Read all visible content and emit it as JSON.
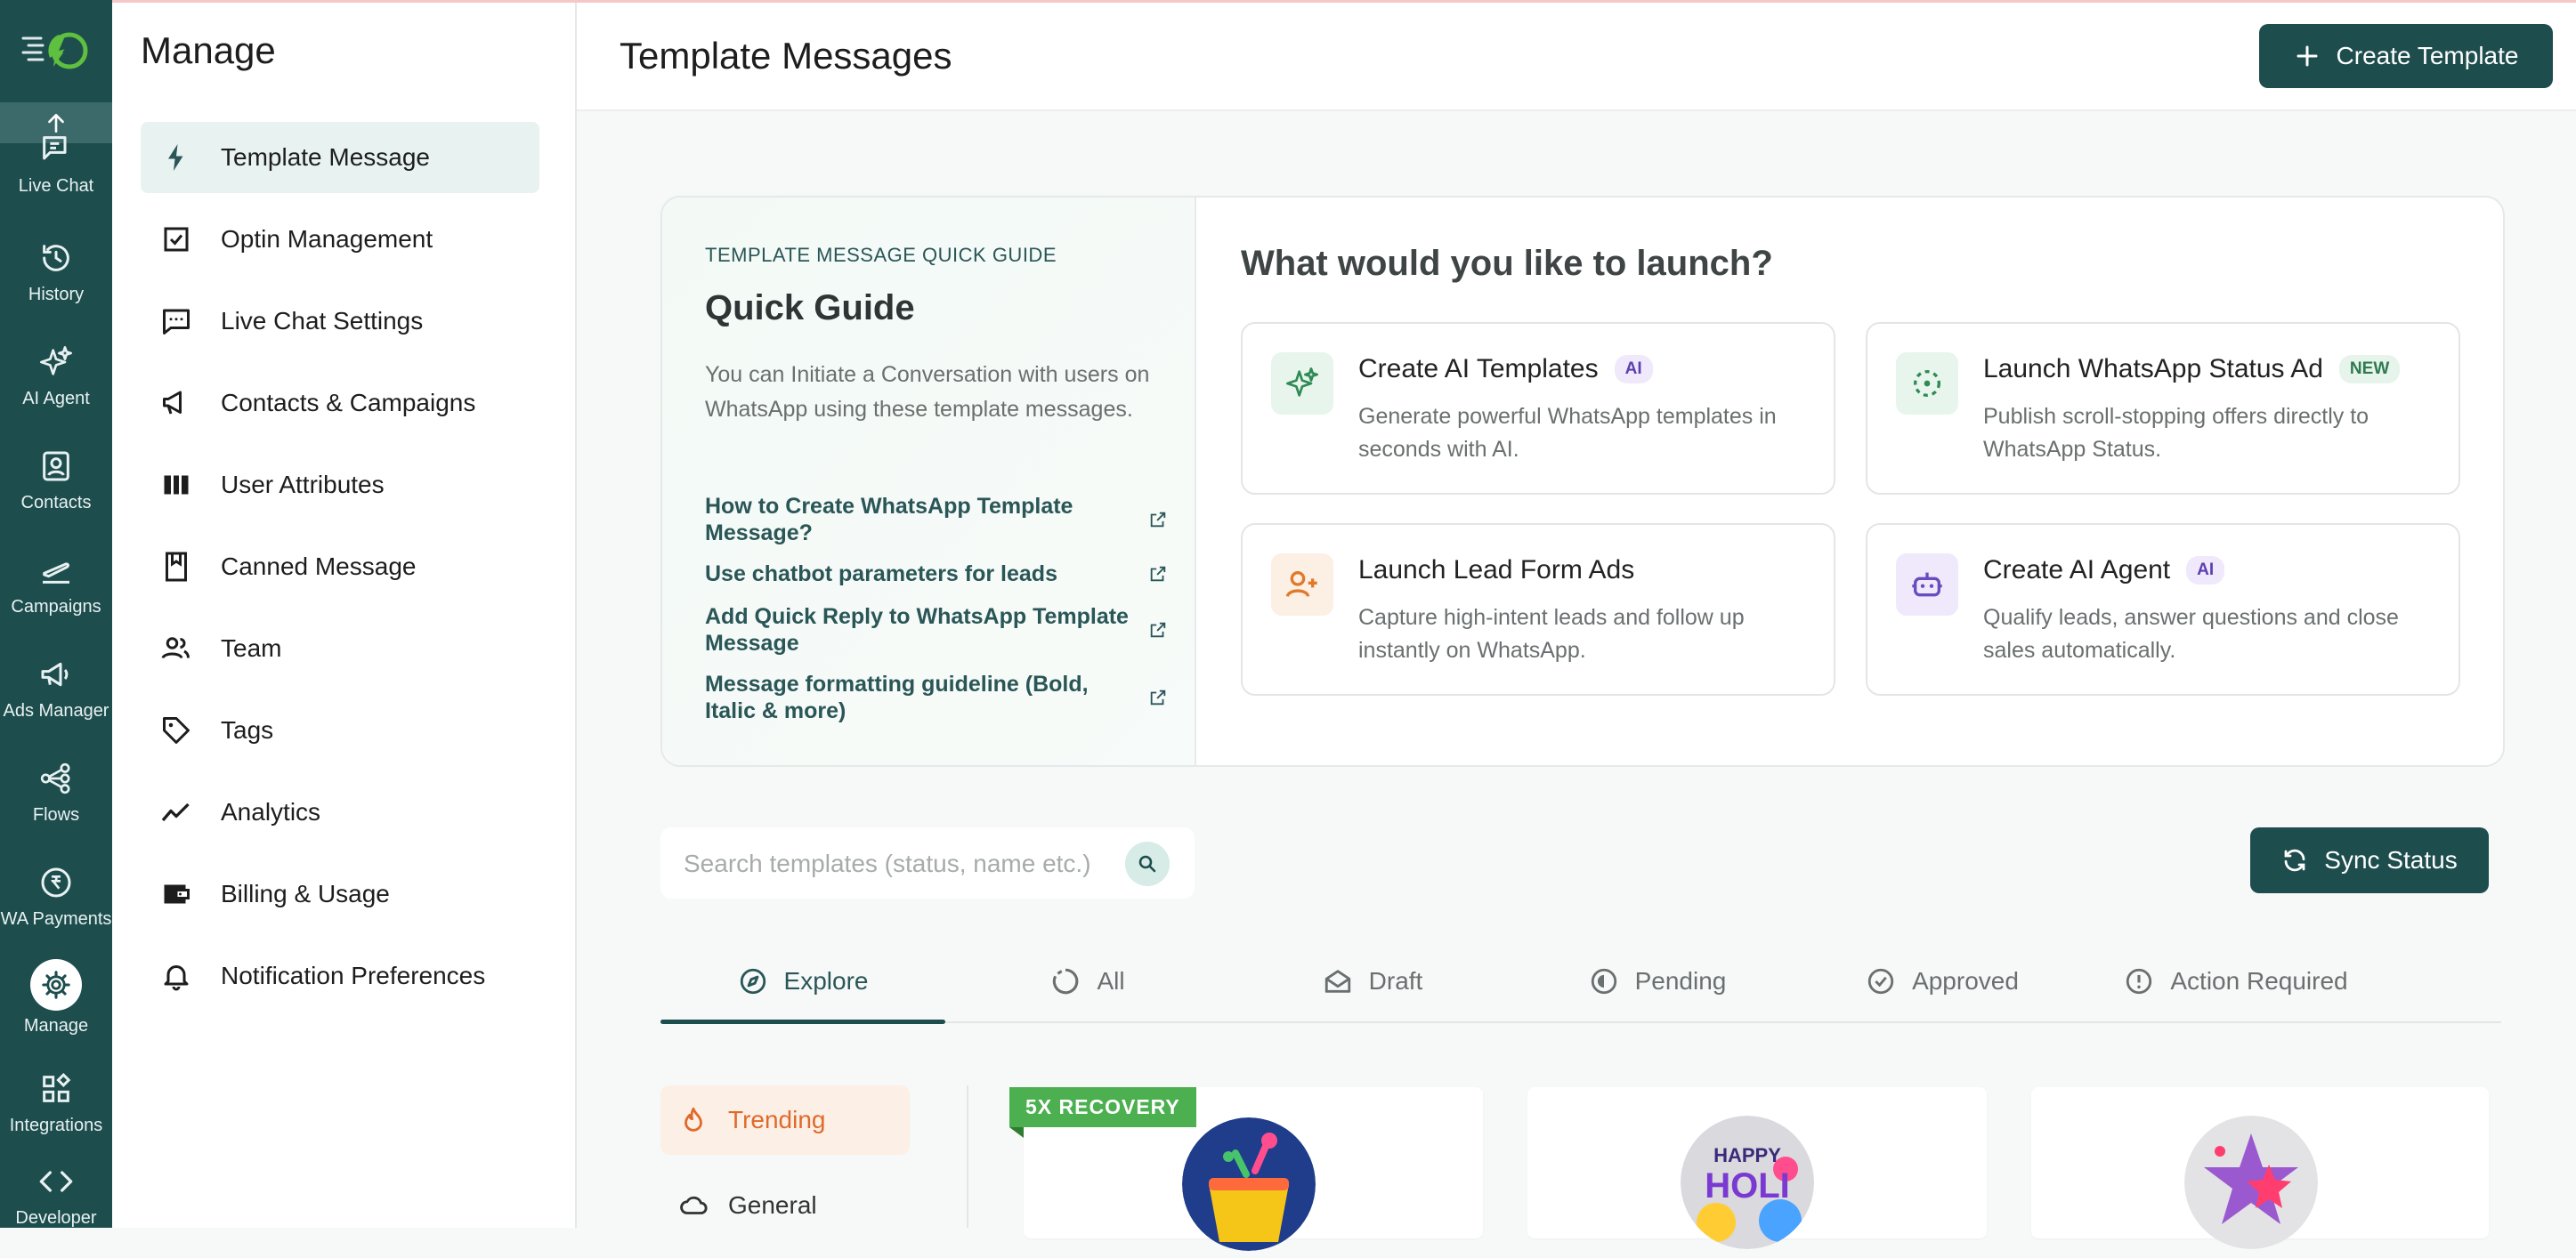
{
  "rail": {
    "items": [
      {
        "label": "Live Chat"
      },
      {
        "label": "History"
      },
      {
        "label": "AI Agent"
      },
      {
        "label": "Contacts"
      },
      {
        "label": "Campaigns"
      },
      {
        "label": "Ads Manager"
      },
      {
        "label": "Flows"
      },
      {
        "label": "WA Payments"
      },
      {
        "label": "Manage"
      },
      {
        "label": "Integrations"
      },
      {
        "label": "Developer"
      }
    ]
  },
  "manage": {
    "title": "Manage",
    "items": [
      {
        "label": "Template Message",
        "icon": "lightning-icon",
        "active": true
      },
      {
        "label": "Optin Management",
        "icon": "checkbox-icon"
      },
      {
        "label": "Live Chat Settings",
        "icon": "chat-bubble-icon"
      },
      {
        "label": "Contacts & Campaigns",
        "icon": "megaphone-icon"
      },
      {
        "label": "User Attributes",
        "icon": "columns-icon"
      },
      {
        "label": "Canned Message",
        "icon": "bookmark-icon"
      },
      {
        "label": "Team",
        "icon": "team-icon"
      },
      {
        "label": "Tags",
        "icon": "tag-icon"
      },
      {
        "label": "Analytics",
        "icon": "trend-icon"
      },
      {
        "label": "Billing & Usage",
        "icon": "wallet-icon"
      },
      {
        "label": "Notification Preferences",
        "icon": "bell-icon"
      }
    ]
  },
  "header": {
    "title": "Template Messages",
    "create_button": "Create Template"
  },
  "guide": {
    "eyebrow": "TEMPLATE MESSAGE QUICK GUIDE",
    "title": "Quick Guide",
    "description": "You can Initiate a Conversation with users on WhatsApp using these template messages.",
    "links": [
      "How to Create WhatsApp Template Message?",
      "Use chatbot parameters for leads",
      "Add Quick Reply to WhatsApp Template Message",
      "Message formatting guideline (Bold, Italic & more)"
    ],
    "launch_question": "What would you like to launch?",
    "launch_cards": [
      {
        "title": "Create AI Templates",
        "badge": "AI",
        "description": "Generate powerful WhatsApp templates in seconds with AI."
      },
      {
        "title": "Launch WhatsApp Status Ad",
        "badge": "NEW",
        "description": "Publish scroll-stopping offers directly to WhatsApp Status."
      },
      {
        "title": "Launch Lead Form Ads",
        "badge": "",
        "description": "Capture high-intent leads and follow up instantly on WhatsApp."
      },
      {
        "title": "Create AI Agent",
        "badge": "AI",
        "description": "Qualify leads, answer questions and close sales automatically."
      }
    ]
  },
  "search": {
    "placeholder": "Search templates (status, name etc.)",
    "value": ""
  },
  "sync_button": "Sync Status",
  "tabs": [
    {
      "label": "Explore",
      "active": true
    },
    {
      "label": "All"
    },
    {
      "label": "Draft"
    },
    {
      "label": "Pending"
    },
    {
      "label": "Approved"
    },
    {
      "label": "Action Required"
    }
  ],
  "categories": [
    {
      "label": "Trending",
      "active": true
    },
    {
      "label": "General"
    }
  ],
  "template_cards": [
    {
      "ribbon": "5X RECOVERY"
    },
    {
      "ribbon": "",
      "image_text": "HAPPY HOLI"
    },
    {
      "ribbon": ""
    }
  ],
  "colors": {
    "primary": "#1e4d4e",
    "accent_light": "#e8f3f1",
    "trending": "#e06a2a",
    "ribbon": "#4caf50"
  }
}
